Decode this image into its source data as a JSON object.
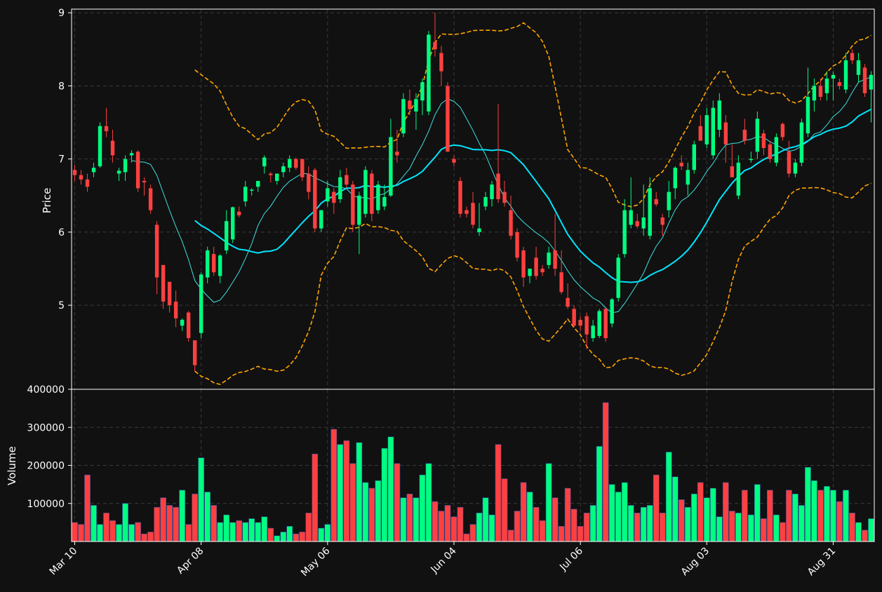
{
  "chart_data": {
    "type": "candlestick",
    "title": "",
    "colors": {
      "background": "#111111",
      "up": "#00ff80",
      "down": "#ff4040",
      "ma_fast": "#40e0e0",
      "ma_slow": "#00e5ff",
      "bollinger": "#ffa500",
      "grid": "#3a3a3a",
      "text": "#ffffff"
    },
    "price_panel": {
      "ylabel": "Price",
      "ylim": [
        3.85,
        9.05
      ],
      "yticks": [
        5,
        6,
        7,
        8,
        9
      ]
    },
    "volume_panel": {
      "ylabel": "Volume",
      "ylim": [
        0,
        400000
      ],
      "yticks": [
        100000,
        200000,
        300000,
        400000
      ]
    },
    "x_tick_labels": [
      {
        "label": "Mar 10",
        "index": 0
      },
      {
        "label": "Apr 08",
        "index": 20
      },
      {
        "label": "May 06",
        "index": 40
      },
      {
        "label": "Jun 04",
        "index": 60
      },
      {
        "label": "Jul 06",
        "index": 80
      },
      {
        "label": "Aug 03",
        "index": 100
      },
      {
        "label": "Aug 31",
        "index": 120
      }
    ],
    "candles": [
      [
        6.85,
        6.92,
        6.7,
        6.78,
        50000
      ],
      [
        6.78,
        6.85,
        6.65,
        6.72,
        45000
      ],
      [
        6.72,
        6.8,
        6.55,
        6.62,
        175000
      ],
      [
        6.82,
        6.95,
        6.75,
        6.88,
        95000
      ],
      [
        6.9,
        7.5,
        6.88,
        7.45,
        45000
      ],
      [
        7.45,
        7.7,
        7.3,
        7.38,
        75000
      ],
      [
        7.25,
        7.4,
        6.95,
        7.05,
        55000
      ],
      [
        6.8,
        6.88,
        6.7,
        6.84,
        45000
      ],
      [
        6.82,
        7.05,
        6.7,
        7.0,
        100000
      ],
      [
        7.05,
        7.12,
        6.95,
        7.08,
        45000
      ],
      [
        7.1,
        7.12,
        6.55,
        6.6,
        50000
      ],
      [
        6.7,
        6.75,
        6.5,
        6.68,
        20000
      ],
      [
        6.6,
        6.65,
        6.25,
        6.3,
        25000
      ],
      [
        6.1,
        6.15,
        5.15,
        5.38,
        90000
      ],
      [
        5.55,
        5.55,
        4.95,
        5.05,
        115000
      ],
      [
        5.32,
        5.32,
        4.9,
        5.0,
        95000
      ],
      [
        5.05,
        5.2,
        4.7,
        4.82,
        90000
      ],
      [
        4.72,
        4.82,
        4.65,
        4.8,
        135000
      ],
      [
        4.9,
        4.92,
        4.5,
        4.55,
        45000
      ],
      [
        4.52,
        4.52,
        4.1,
        4.18,
        125000
      ],
      [
        4.62,
        5.45,
        4.55,
        5.42,
        220000
      ],
      [
        5.38,
        5.8,
        5.3,
        5.75,
        130000
      ],
      [
        5.7,
        5.8,
        5.4,
        5.45,
        95000
      ],
      [
        5.4,
        5.7,
        5.3,
        5.68,
        50000
      ],
      [
        5.75,
        6.3,
        5.7,
        6.15,
        70000
      ],
      [
        5.9,
        6.35,
        5.85,
        6.34,
        50000
      ],
      [
        6.28,
        6.35,
        6.2,
        6.23,
        55000
      ],
      [
        6.42,
        6.7,
        6.35,
        6.62,
        50000
      ],
      [
        6.58,
        6.6,
        6.5,
        6.58,
        60000
      ],
      [
        6.62,
        6.7,
        6.55,
        6.7,
        50000
      ],
      [
        6.9,
        7.05,
        6.8,
        7.02,
        65000
      ],
      [
        6.8,
        6.82,
        6.68,
        6.78,
        35000
      ],
      [
        6.7,
        6.8,
        6.65,
        6.8,
        15000
      ],
      [
        6.82,
        6.95,
        6.75,
        6.9,
        25000
      ],
      [
        6.88,
        7.05,
        6.82,
        7.0,
        40000
      ],
      [
        7.0,
        7.02,
        6.85,
        6.88,
        20000
      ],
      [
        7.0,
        7.0,
        6.7,
        6.75,
        25000
      ],
      [
        6.8,
        6.9,
        6.45,
        6.55,
        75000
      ],
      [
        6.85,
        6.88,
        6.0,
        6.05,
        230000
      ],
      [
        6.05,
        6.3,
        6.0,
        6.3,
        35000
      ],
      [
        6.42,
        6.7,
        6.35,
        6.6,
        45000
      ],
      [
        6.55,
        6.6,
        6.25,
        6.4,
        295000
      ],
      [
        6.45,
        6.85,
        6.4,
        6.75,
        255000
      ],
      [
        6.78,
        6.88,
        6.6,
        6.65,
        265000
      ],
      [
        6.65,
        6.7,
        6.0,
        6.1,
        205000
      ],
      [
        6.1,
        6.55,
        5.7,
        6.5,
        260000
      ],
      [
        6.25,
        6.9,
        6.2,
        6.85,
        155000
      ],
      [
        6.8,
        6.85,
        6.15,
        6.25,
        140000
      ],
      [
        6.3,
        6.7,
        6.25,
        6.65,
        160000
      ],
      [
        6.35,
        6.65,
        6.3,
        6.48,
        245000
      ],
      [
        6.5,
        7.55,
        6.48,
        7.3,
        275000
      ],
      [
        7.1,
        7.4,
        6.95,
        7.05,
        205000
      ],
      [
        7.35,
        7.9,
        7.3,
        7.82,
        115000
      ],
      [
        7.8,
        7.95,
        7.6,
        7.68,
        125000
      ],
      [
        7.65,
        7.9,
        7.4,
        7.82,
        115000
      ],
      [
        7.8,
        8.1,
        7.6,
        8.05,
        175000
      ],
      [
        7.65,
        8.75,
        7.6,
        8.7,
        205000
      ],
      [
        8.6,
        9.0,
        8.4,
        8.5,
        105000
      ],
      [
        8.45,
        8.55,
        8.0,
        8.2,
        80000
      ],
      [
        8.0,
        8.05,
        7.1,
        7.1,
        95000
      ],
      [
        7.0,
        7.05,
        6.9,
        6.95,
        65000
      ],
      [
        6.7,
        6.75,
        6.2,
        6.25,
        90000
      ],
      [
        6.3,
        6.35,
        6.2,
        6.25,
        20000
      ],
      [
        6.4,
        6.55,
        6.05,
        6.1,
        45000
      ],
      [
        6.0,
        6.4,
        5.95,
        6.05,
        75000
      ],
      [
        6.35,
        6.55,
        6.3,
        6.48,
        115000
      ],
      [
        6.45,
        6.7,
        6.35,
        6.65,
        70000
      ],
      [
        6.8,
        7.75,
        6.4,
        6.45,
        255000
      ],
      [
        6.55,
        6.7,
        6.35,
        6.4,
        165000
      ],
      [
        6.3,
        6.5,
        5.9,
        5.95,
        30000
      ],
      [
        6.0,
        6.05,
        5.6,
        5.65,
        80000
      ],
      [
        5.75,
        5.8,
        5.25,
        5.38,
        155000
      ],
      [
        5.4,
        5.5,
        5.3,
        5.5,
        130000
      ],
      [
        5.65,
        5.8,
        5.35,
        5.4,
        90000
      ],
      [
        5.5,
        5.55,
        5.4,
        5.45,
        55000
      ],
      [
        5.55,
        5.8,
        5.5,
        5.72,
        205000
      ],
      [
        5.75,
        6.25,
        5.4,
        5.5,
        115000
      ],
      [
        5.45,
        5.75,
        5.15,
        5.18,
        40000
      ],
      [
        5.1,
        5.3,
        4.95,
        4.98,
        140000
      ],
      [
        4.95,
        5.0,
        4.7,
        4.72,
        85000
      ],
      [
        4.8,
        4.85,
        4.65,
        4.72,
        40000
      ],
      [
        4.85,
        4.9,
        4.4,
        4.6,
        75000
      ],
      [
        4.55,
        4.8,
        4.5,
        4.72,
        95000
      ],
      [
        4.58,
        4.95,
        4.55,
        4.92,
        250000
      ],
      [
        4.95,
        4.98,
        4.5,
        4.55,
        365000
      ],
      [
        4.75,
        5.1,
        4.7,
        5.08,
        150000
      ],
      [
        5.1,
        5.7,
        5.05,
        5.65,
        130000
      ],
      [
        5.7,
        6.45,
        5.65,
        6.3,
        155000
      ],
      [
        6.1,
        6.75,
        6.05,
        6.3,
        95000
      ],
      [
        6.15,
        6.25,
        6.05,
        6.08,
        75000
      ],
      [
        6.05,
        6.65,
        5.95,
        6.2,
        90000
      ],
      [
        5.95,
        6.75,
        5.9,
        6.6,
        95000
      ],
      [
        6.45,
        6.55,
        6.35,
        6.38,
        175000
      ],
      [
        6.2,
        6.25,
        5.95,
        6.1,
        75000
      ],
      [
        6.3,
        6.7,
        6.2,
        6.55,
        235000
      ],
      [
        6.6,
        6.9,
        6.45,
        6.88,
        170000
      ],
      [
        6.95,
        7.05,
        6.85,
        6.9,
        110000
      ],
      [
        6.65,
        6.95,
        6.5,
        6.85,
        90000
      ],
      [
        6.85,
        7.25,
        6.8,
        7.2,
        125000
      ],
      [
        7.45,
        7.6,
        7.25,
        7.25,
        155000
      ],
      [
        7.2,
        7.7,
        7.15,
        7.6,
        115000
      ],
      [
        7.05,
        7.8,
        7.0,
        7.7,
        140000
      ],
      [
        7.4,
        7.9,
        7.3,
        7.8,
        65000
      ],
      [
        7.5,
        7.6,
        6.95,
        7.2,
        155000
      ],
      [
        6.9,
        7.2,
        6.8,
        6.75,
        80000
      ],
      [
        6.5,
        7.05,
        6.45,
        6.95,
        75000
      ],
      [
        7.4,
        7.55,
        7.2,
        7.25,
        135000
      ],
      [
        7.0,
        7.1,
        6.95,
        7.0,
        70000
      ],
      [
        7.1,
        7.65,
        7.0,
        7.55,
        150000
      ],
      [
        7.35,
        7.4,
        7.05,
        7.15,
        60000
      ],
      [
        7.2,
        7.25,
        6.95,
        7.0,
        135000
      ],
      [
        6.95,
        7.35,
        6.9,
        7.3,
        70000
      ],
      [
        7.48,
        7.5,
        7.25,
        7.3,
        50000
      ],
      [
        7.1,
        7.25,
        6.75,
        6.8,
        135000
      ],
      [
        6.8,
        7.0,
        6.75,
        6.95,
        125000
      ],
      [
        6.95,
        7.55,
        6.9,
        7.5,
        95000
      ],
      [
        7.35,
        8.25,
        7.3,
        7.85,
        195000
      ],
      [
        7.8,
        8.1,
        7.65,
        8.0,
        160000
      ],
      [
        8.0,
        8.1,
        7.8,
        7.85,
        135000
      ],
      [
        7.9,
        8.2,
        7.8,
        8.1,
        145000
      ],
      [
        8.1,
        8.2,
        7.8,
        8.15,
        135000
      ],
      [
        8.05,
        8.1,
        7.95,
        8.0,
        105000
      ],
      [
        7.95,
        8.45,
        7.9,
        8.35,
        135000
      ],
      [
        8.45,
        8.5,
        8.3,
        8.35,
        75000
      ],
      [
        8.15,
        8.45,
        8.05,
        8.35,
        50000
      ],
      [
        8.25,
        8.3,
        7.85,
        7.9,
        30000
      ],
      [
        7.95,
        8.2,
        7.5,
        8.15,
        60000
      ]
    ]
  }
}
